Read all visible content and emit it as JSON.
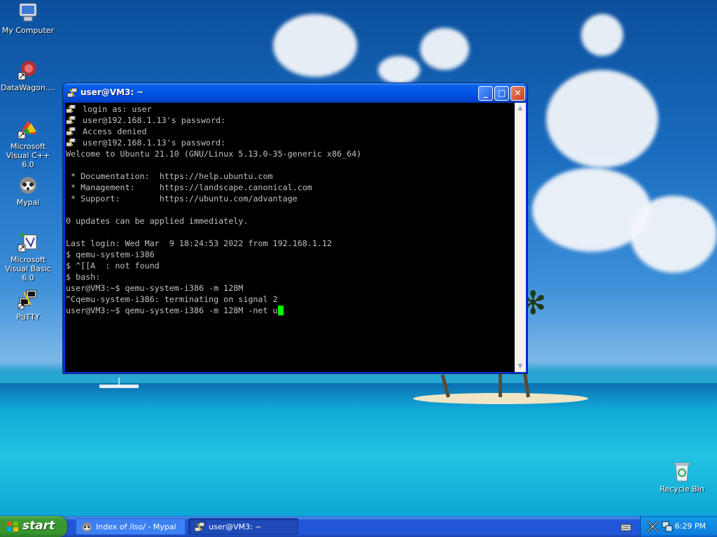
{
  "desktop": {
    "icons": [
      {
        "label": "My Computer",
        "icon": "my-computer-icon"
      },
      {
        "label": "DataWagon....",
        "icon": "datawagon-icon"
      },
      {
        "label": "Microsoft Visual C++ 6.0",
        "icon": "visual-cpp-icon"
      },
      {
        "label": "Mypal",
        "icon": "mypal-icon"
      },
      {
        "label": "Microsoft Visual Basic 6.0",
        "icon": "visual-basic-icon"
      },
      {
        "label": "PuTTY",
        "icon": "putty-icon"
      },
      {
        "label": "Recycle Bin",
        "icon": "recycle-bin-icon"
      }
    ]
  },
  "window": {
    "title": "user@VM3: ~",
    "buttons": {
      "minimize": "_",
      "maximize": "□",
      "close": "✕"
    },
    "terminal": {
      "lines": [
        {
          "icon": true,
          "text": "login as: user"
        },
        {
          "icon": true,
          "text": "user@192.168.1.13's password:"
        },
        {
          "icon": true,
          "text": "Access denied"
        },
        {
          "icon": true,
          "text": "user@192.168.1.13's password:"
        },
        {
          "icon": false,
          "text": "Welcome to Ubuntu 21.10 (GNU/Linux 5.13.0-35-generic x86_64)"
        },
        {
          "icon": false,
          "text": ""
        },
        {
          "icon": false,
          "text": " * Documentation:  https://help.ubuntu.com"
        },
        {
          "icon": false,
          "text": " * Management:     https://landscape.canonical.com"
        },
        {
          "icon": false,
          "text": " * Support:        https://ubuntu.com/advantage"
        },
        {
          "icon": false,
          "text": ""
        },
        {
          "icon": false,
          "text": "0 updates can be applied immediately."
        },
        {
          "icon": false,
          "text": ""
        },
        {
          "icon": false,
          "text": "Last login: Wed Mar  9 18:24:53 2022 from 192.168.1.12"
        },
        {
          "icon": false,
          "text": "$ qemu-system-i386"
        },
        {
          "icon": false,
          "text": "$ ^[[A  : not found"
        },
        {
          "icon": false,
          "text": "$ bash:"
        },
        {
          "icon": false,
          "text": "user@VM3:~$ qemu-system-i386 -m 128M"
        },
        {
          "icon": false,
          "text": "^Cqemu-system-i386: terminating on signal 2"
        },
        {
          "icon": false,
          "text": "user@VM3:~$ qemu-system-i386 -m 128M -net u",
          "cursor": true
        }
      ]
    }
  },
  "taskbar": {
    "start_label": "start",
    "tasks": [
      {
        "label": "Index of /iso/ - Mypal",
        "icon": "mypal-icon",
        "active": false
      },
      {
        "label": "user@VM3: ~",
        "icon": "putty-icon",
        "active": true
      }
    ],
    "clock": "6:29 PM"
  },
  "colors": {
    "terminal_bg": "#000000",
    "terminal_fg": "#c0c0c0",
    "cursor": "#00ff00",
    "titlebar": "#0055e5",
    "start_button": "#3c9a34"
  }
}
